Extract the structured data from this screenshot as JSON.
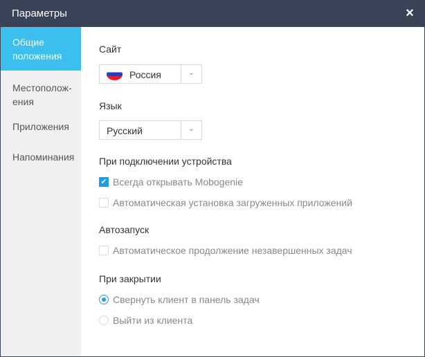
{
  "window": {
    "title": "Параметры",
    "close_icon": "×"
  },
  "sidebar": {
    "items": [
      {
        "label": "Общие положения"
      },
      {
        "label": "Местополож-ения"
      },
      {
        "label": "Приложения"
      },
      {
        "label": "Напоминания"
      }
    ]
  },
  "site": {
    "label": "Сайт",
    "value": "Россия"
  },
  "language": {
    "label": "Язык",
    "value": "Русский"
  },
  "device": {
    "label": "При подключении устройства",
    "opt1": "Всегда открывать Mobogenie",
    "opt1_checked": true,
    "opt2": "Автоматическая установка загруженных приложений",
    "opt2_checked": false
  },
  "autostart": {
    "label": "Автозапуск",
    "opt1": "Автоматическое продолжение незавершенных задач",
    "opt1_checked": false
  },
  "on_close": {
    "label": "При закрытии",
    "opt1": "Свернуть клиент в панель задач",
    "opt2": "Выйти из клиента",
    "selected": "opt1"
  },
  "colors": {
    "accent": "#3bbfec",
    "titlebar": "#384357"
  }
}
